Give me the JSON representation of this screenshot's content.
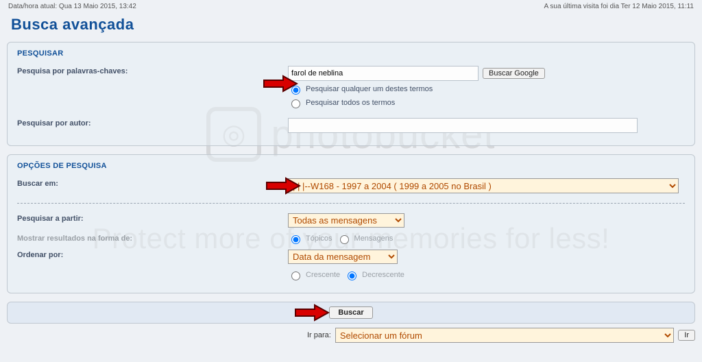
{
  "meta": {
    "left_status": "Data/hora atual: Qua 13 Maio 2015, 13:42",
    "right_status": "A sua última visita foi dia Ter 12 Maio 2015, 11:11"
  },
  "title": "Busca avançada",
  "watermark": {
    "brand": "photobucket",
    "tagline": "Protect more of your memories for less!"
  },
  "search_panel": {
    "header": "PESQUISAR",
    "keywords_label": "Pesquisa por palavras-chaves:",
    "keywords_value": "farol de neblina",
    "google_button": "Buscar Google",
    "term_mode_any": "Pesquisar qualquer um destes termos",
    "term_mode_all": "Pesquisar todos os termos",
    "term_mode_selected": "any",
    "author_label": "Pesquisar por autor:",
    "author_value": ""
  },
  "options_panel": {
    "header": "OPÇÕES DE PESQUISA",
    "search_in_label": "Buscar em:",
    "search_in_value": "|   |   |--W168 - 1997 a 2004 ( 1999 a 2005 no Brasil )",
    "since_label": "Pesquisar a partir:",
    "since_value": "Todas as mensagens",
    "display_as_label": "Mostrar resultados na forma de:",
    "display_as_topics": "Tópicos",
    "display_as_posts": "Mensagens",
    "display_as_selected": "topics",
    "sort_label": "Ordenar por:",
    "sort_value": "Data da mensagem",
    "dir_asc": "Crescente",
    "dir_desc": "Decrescente",
    "dir_selected": "desc"
  },
  "submit": {
    "button": "Buscar"
  },
  "jump": {
    "label": "Ir para:",
    "value": "Selecionar um fórum",
    "go": "Ir"
  },
  "colors": {
    "heading": "#115098",
    "accent_bg": "#fff4dc",
    "accent_fg": "#b04a00"
  }
}
